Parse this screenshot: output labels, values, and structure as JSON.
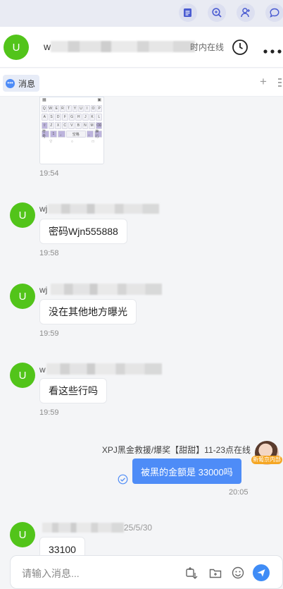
{
  "header": {
    "avatar_letter": "U",
    "name_prefix": "w",
    "online_status_fragment": "时内在线"
  },
  "tabs": [
    {
      "label": "消息"
    }
  ],
  "tabbar": {
    "add_symbol": "+"
  },
  "keyboard_preview": {
    "rows": [
      [
        "Q",
        "W",
        "E",
        "R",
        "T",
        "Y",
        "U",
        "I",
        "O",
        "P"
      ],
      [
        "A",
        "S",
        "D",
        "F",
        "G",
        "H",
        "J",
        "K",
        "L"
      ],
      [
        "⇧",
        "Z",
        "X",
        "C",
        "V",
        "B",
        "N",
        "M",
        "⌫"
      ],
      [
        "符号",
        "1",
        "，",
        "空格",
        "。",
        "换行"
      ]
    ]
  },
  "messages": [
    {
      "kind": "image",
      "time": "19:54"
    },
    {
      "kind": "text",
      "avatar": "U",
      "name_prefix": "wj",
      "text": "密码Wjn555888",
      "time": "19:58"
    },
    {
      "kind": "text",
      "avatar": "U",
      "name_prefix": "wj",
      "text": "没在其他地方曝光",
      "time": "19:59"
    },
    {
      "kind": "text",
      "avatar": "U",
      "name_prefix": "w",
      "text": "看这些行吗",
      "time": "19:59"
    },
    {
      "kind": "self",
      "sender": "XPJ黑金救援/爆奖【甜甜】11-23点在线",
      "badge": "新葡京内部",
      "text": "被黑的金额是 33000吗",
      "time": "20:05"
    },
    {
      "kind": "text",
      "avatar": "U",
      "name_suffix": "25/5/30",
      "text": "33100"
    }
  ],
  "composer": {
    "placeholder": "请输入消息..."
  },
  "colors": {
    "accent": "#4e8cf7",
    "avatar": "#52c41a",
    "badge": "#f5a623"
  }
}
